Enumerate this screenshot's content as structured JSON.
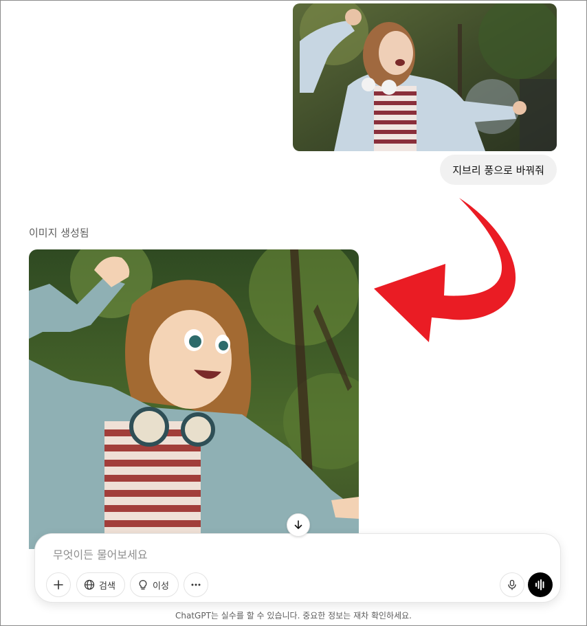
{
  "user_message": {
    "photo_alt": "user photo",
    "text": "지브리 풍으로 바꿔줘"
  },
  "assistant": {
    "label": "이미지 생성됨"
  },
  "composer": {
    "placeholder": "무엇이든 물어보세요",
    "search_label": "검색",
    "reason_label": "이성"
  },
  "disclaimer": "ChatGPT는 실수를 할 수 있습니다. 중요한 정보는 재차 확인하세요.",
  "colors": {
    "arrow": "#ea1c24",
    "bubble": "#f1f1f1",
    "voice_button": "#000000"
  },
  "icons": [
    "scroll-down-icon",
    "plus-icon",
    "globe-icon",
    "bulb-icon",
    "more-icon",
    "mic-icon",
    "voice-wave-icon"
  ]
}
